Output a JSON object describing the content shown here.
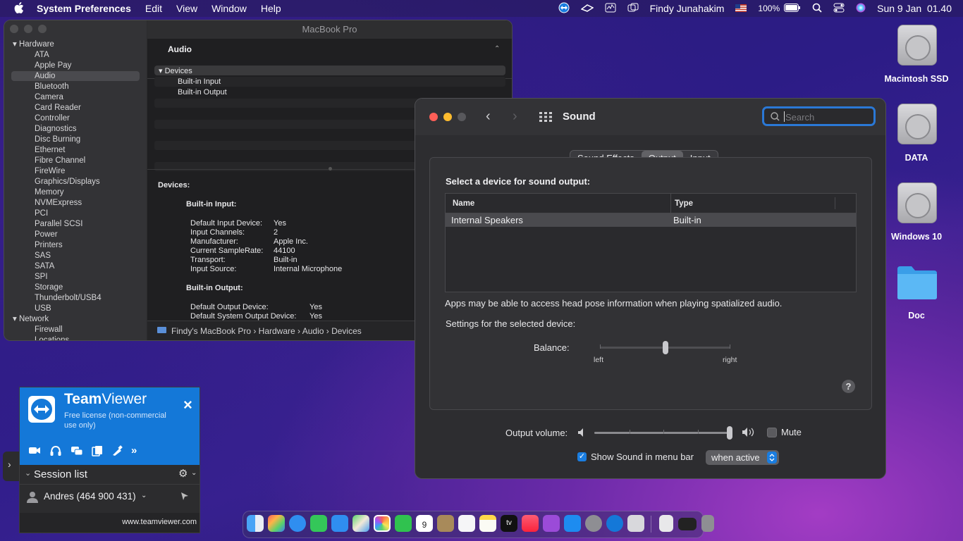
{
  "menubar": {
    "app_name": "System Preferences",
    "menus": [
      "Edit",
      "View",
      "Window",
      "Help"
    ],
    "user": "Findy Junahakim",
    "battery": "100%",
    "datetime": "Sun 9 Jan  01.40"
  },
  "sysinfo": {
    "title": "MacBook Pro",
    "sidebar": {
      "hardware_label": "Hardware",
      "items": [
        "ATA",
        "Apple Pay",
        "Audio",
        "Bluetooth",
        "Camera",
        "Card Reader",
        "Controller",
        "Diagnostics",
        "Disc Burning",
        "Ethernet",
        "Fibre Channel",
        "FireWire",
        "Graphics/Displays",
        "Memory",
        "NVMExpress",
        "PCI",
        "Parallel SCSI",
        "Power",
        "Printers",
        "SAS",
        "SATA",
        "SPI",
        "Storage",
        "Thunderbolt/USB4",
        "USB"
      ],
      "network_label": "Network",
      "network_items": [
        "Firewall",
        "Locations"
      ],
      "selected": "Audio"
    },
    "section_header": "Audio",
    "tree": {
      "root": "Devices",
      "children": [
        "Built-in Input",
        "Built-in Output"
      ]
    },
    "details": {
      "devices_label": "Devices:",
      "input_heading": "Built-in Input:",
      "input_props": [
        [
          "Default Input Device:",
          "Yes"
        ],
        [
          "Input Channels:",
          "2"
        ],
        [
          "Manufacturer:",
          "Apple Inc."
        ],
        [
          "Current SampleRate:",
          "44100"
        ],
        [
          "Transport:",
          "Built-in"
        ],
        [
          "Input Source:",
          "Internal Microphone"
        ]
      ],
      "output_heading": "Built-in Output:",
      "output_props": [
        [
          "Default Output Device:",
          "Yes"
        ],
        [
          "Default System Output Device:",
          "Yes"
        ]
      ]
    },
    "path": [
      "Findy's MacBook Pro",
      "Hardware",
      "Audio",
      "Devices"
    ]
  },
  "sound": {
    "title": "Sound",
    "search_placeholder": "Search",
    "tabs": [
      "Sound Effects",
      "Output",
      "Input"
    ],
    "selected_tab": "Output",
    "select_label": "Select a device for sound output:",
    "table": {
      "headers": [
        "Name",
        "Type"
      ],
      "rows": [
        [
          "Internal Speakers",
          "Built-in"
        ]
      ]
    },
    "spatial_note": "Apps may be able to access head pose information when playing spatialized audio.",
    "settings_label": "Settings for the selected device:",
    "balance_label": "Balance:",
    "balance_left": "left",
    "balance_right": "right",
    "balance_value": 0.5,
    "help": "?",
    "volume_label": "Output volume:",
    "volume_value": 1.0,
    "mute_label": "Mute",
    "mute_checked": false,
    "show_in_menubar_label": "Show Sound in menu bar",
    "show_in_menubar_checked": true,
    "menubar_mode": "when active"
  },
  "desktop": {
    "icons": [
      "Macintosh SSD",
      "DATA",
      "Windows 10",
      "Doc"
    ]
  },
  "teamviewer": {
    "brand_bold": "Team",
    "brand_light": "Viewer",
    "license": "Free license (non-commercial use only)",
    "close": "×",
    "session_list": "Session list",
    "contact": "Andres (464 900 431)",
    "url": "www.teamviewer.com"
  },
  "dock": {
    "calendar_day": "9",
    "tv_label": "tv"
  },
  "colors": {
    "accent": "#0a84ff",
    "selection": "#4a4a4e",
    "teamviewer_blue": "#1478d8"
  }
}
